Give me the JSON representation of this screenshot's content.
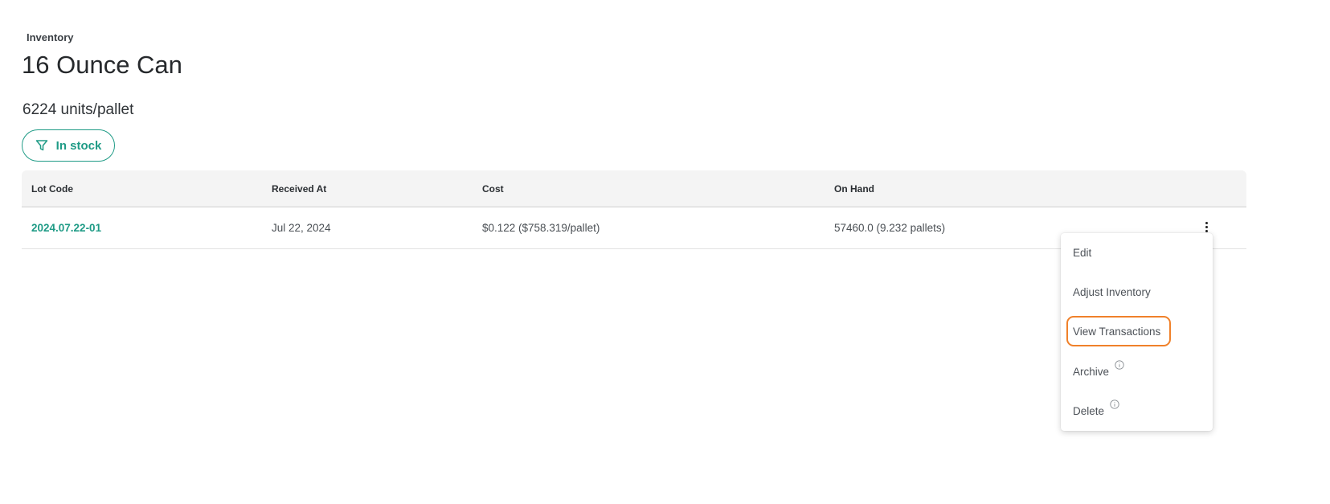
{
  "breadcrumb": "Inventory",
  "title": "16 Ounce Can",
  "subtitle": "6224 units/pallet",
  "filter": {
    "label": "In stock",
    "icon": "filter-icon"
  },
  "table": {
    "columns": [
      "Lot Code",
      "Received At",
      "Cost",
      "On Hand"
    ],
    "rows": [
      {
        "lot_code": "2024.07.22-01",
        "received_at": "Jul 22, 2024",
        "cost": "$0.122 ($758.319/pallet)",
        "on_hand": "57460.0 (9.232 pallets)"
      }
    ]
  },
  "row_menu": {
    "items": [
      {
        "label": "Edit"
      },
      {
        "label": "Adjust Inventory"
      },
      {
        "label": "View Transactions",
        "highlighted": true
      },
      {
        "label": "Archive",
        "icon": "info-icon"
      },
      {
        "label": "Delete",
        "icon": "info-icon"
      }
    ]
  },
  "colors": {
    "accent": "#1f9b86",
    "highlight": "#f0812a",
    "header_bg": "#f4f4f4"
  }
}
